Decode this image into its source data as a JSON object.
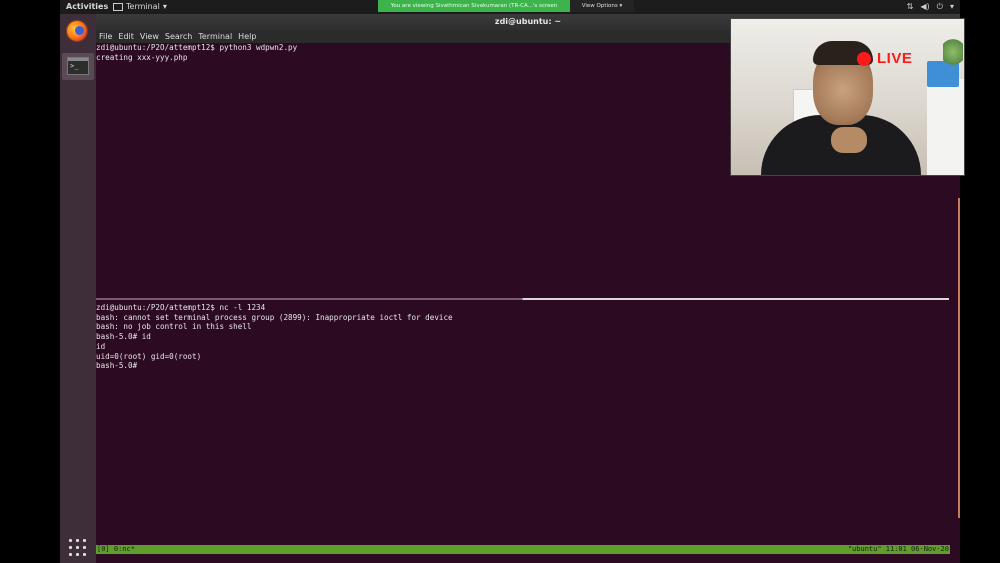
{
  "topbar": {
    "activities": "Activities",
    "app_name": "Terminal",
    "share_banner": "You are viewing Sivathmican Sivakumaran (TR-CA...'s screen",
    "view_options": "View Options"
  },
  "terminal": {
    "window_title": "zdi@ubuntu: ~",
    "menu": [
      "File",
      "Edit",
      "View",
      "Search",
      "Terminal",
      "Help"
    ],
    "top_pane": [
      "zdi@ubuntu:/P2O/attempt12$ python3 wdpwn2.py",
      "creating xxx-yyy.php"
    ],
    "bottom_pane": [
      "zdi@ubuntu:/P2O/attempt12$ nc -l 1234",
      "bash: cannot set terminal process group (2899): Inappropriate ioctl for device",
      "bash: no job control in this shell",
      "bash-5.0# id",
      "id",
      "uid=0(root) gid=0(root)",
      "bash-5.0#"
    ],
    "tmux_left": "[0] 0:nc*",
    "tmux_right": "\"ubuntu\" 11:01 06-Nov-20"
  },
  "webcam": {
    "live_label": "LIVE",
    "live_color": "#ff1a1a"
  },
  "icons": {
    "dock": [
      "firefox-icon",
      "terminal-icon",
      "show-applications-icon"
    ],
    "tray": [
      "network-icon",
      "volume-icon",
      "power-icon",
      "chevron-down-icon"
    ]
  },
  "colors": {
    "terminal_bg": "#2c0a22",
    "tmux_status": "#5f9e2b",
    "share_banner": "#3cb44b"
  }
}
